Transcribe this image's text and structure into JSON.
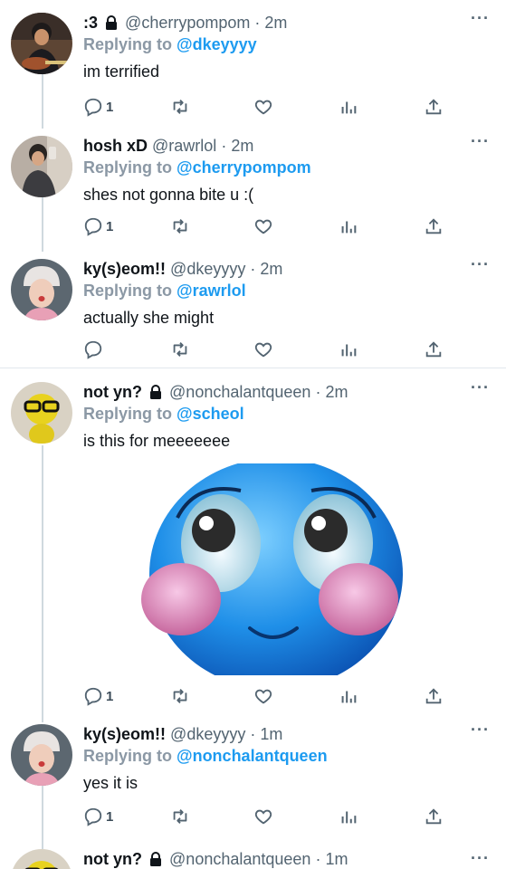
{
  "colors": {
    "accent": "#1d9bf0",
    "text": "#0f1419",
    "muted": "#536471",
    "divider": "#e1e8ed"
  },
  "tweets": [
    {
      "display_name": ":3",
      "locked": true,
      "handle": "@cherrypompom",
      "dot": "·",
      "time": "2m",
      "replying_label": "Replying to",
      "mention": "@dkeyyyy",
      "text": "im terrified",
      "reply_count": "1",
      "avatar": "avatar-guitar-boy"
    },
    {
      "display_name": "hosh xD",
      "locked": false,
      "handle": "@rawrlol",
      "dot": "·",
      "time": "2m",
      "replying_label": "Replying to",
      "mention": "@cherrypompom",
      "text": "shes not gonna bite u :(",
      "reply_count": "1",
      "avatar": "avatar-mirror-selfie"
    },
    {
      "display_name": "ky(s)eom!!",
      "locked": false,
      "handle": "@dkeyyyy",
      "dot": "·",
      "time": "2m",
      "replying_label": "Replying to",
      "mention": "@rawrlol",
      "text": "actually she might",
      "reply_count": "",
      "avatar": "avatar-beanie-person"
    },
    {
      "display_name": "not yn?",
      "locked": true,
      "handle": "@nonchalantqueen",
      "dot": "·",
      "time": "2m",
      "replying_label": "Replying to",
      "mention": "@scheol",
      "text": "is this for meeeeeee",
      "reply_count": "1",
      "avatar": "avatar-yellow-doll",
      "media": "blue-blushing-emoji-image"
    },
    {
      "display_name": "ky(s)eom!!",
      "locked": false,
      "handle": "@dkeyyyy",
      "dot": "·",
      "time": "1m",
      "replying_label": "Replying to",
      "mention": "@nonchalantqueen",
      "text": "yes it is",
      "reply_count": "1",
      "avatar": "avatar-beanie-person"
    },
    {
      "display_name": "not yn?",
      "locked": true,
      "handle": "@nonchalantqueen",
      "dot": "·",
      "time": "1m",
      "avatar": "avatar-yellow-doll"
    }
  ],
  "more_glyph": "···",
  "icons": [
    "reply-icon",
    "retweet-icon",
    "like-icon",
    "analytics-icon",
    "share-icon",
    "lock-icon",
    "more-icon"
  ]
}
